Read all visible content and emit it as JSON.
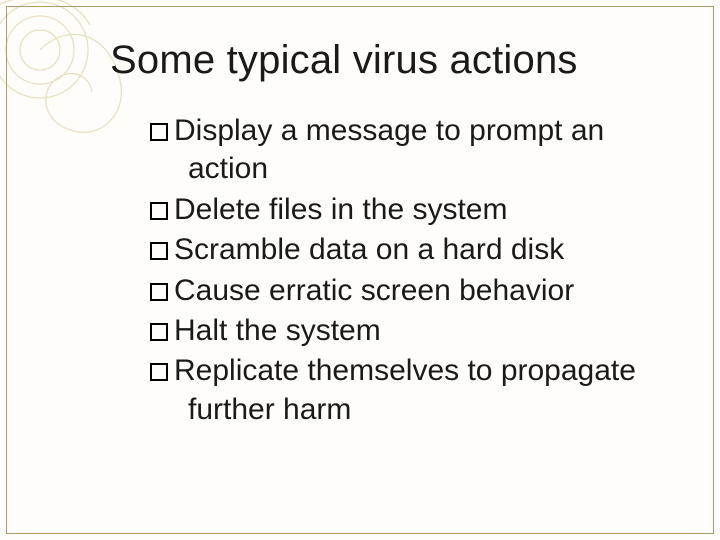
{
  "title": "Some typical virus actions",
  "bullets": [
    "Display a message to prompt an action",
    "Delete files in the system",
    "Scramble data on a hard disk",
    "Cause erratic screen behavior",
    "Halt the system",
    "Replicate themselves to propagate further harm"
  ]
}
